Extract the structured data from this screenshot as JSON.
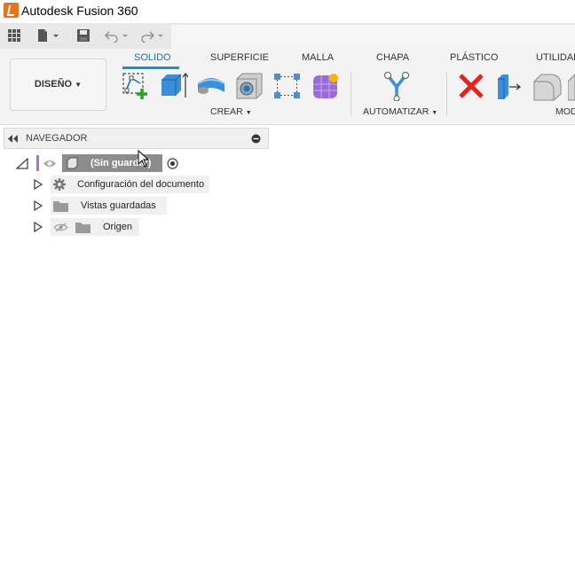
{
  "window": {
    "title": "Autodesk Fusion 360"
  },
  "workspace": {
    "label": "DISEÑO"
  },
  "tabs": [
    {
      "label": "SOLIDO",
      "active": true
    },
    {
      "label": "SUPERFICIE",
      "active": false
    },
    {
      "label": "MALLA",
      "active": false
    },
    {
      "label": "CHAPA",
      "active": false
    },
    {
      "label": "PLÁSTICO",
      "active": false
    },
    {
      "label": "UTILIDAD",
      "active": false
    }
  ],
  "groups": {
    "create": "CREAR",
    "automate": "AUTOMATIZAR",
    "modify": "MOD"
  },
  "navigator": {
    "title": "NAVEGADOR",
    "root": "(Sin guardar)",
    "items": [
      {
        "label": "Configuración del documento"
      },
      {
        "label": "Vistas guardadas"
      },
      {
        "label": "Origen"
      }
    ]
  },
  "colors": {
    "accent": "#1a8fd6",
    "active_tab": "#1a6fbf",
    "root_marker": "#b06fd8"
  }
}
